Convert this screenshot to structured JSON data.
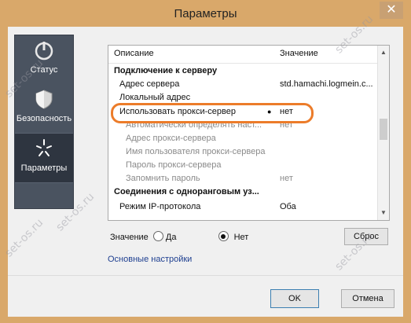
{
  "window": {
    "title": "Параметры",
    "close_glyph": "✕"
  },
  "sidebar": {
    "items": [
      {
        "label": "Статус",
        "icon": "power-icon"
      },
      {
        "label": "Безопасность",
        "icon": "shield-icon"
      },
      {
        "label": "Параметры",
        "icon": "settings-spark-icon",
        "active": true
      }
    ]
  },
  "grid": {
    "headers": {
      "description": "Описание",
      "value": "Значение"
    },
    "rows": [
      {
        "type": "section",
        "description": "Подключение к серверу",
        "value": ""
      },
      {
        "type": "item",
        "description": "Адрес сервера",
        "value": "std.hamachi.logmein.c..."
      },
      {
        "type": "item",
        "description": "Локальный адрес",
        "value": ""
      },
      {
        "type": "item",
        "description": "Использовать прокси-сервер",
        "value": "нет",
        "modified": true
      },
      {
        "type": "dim",
        "description": "Автоматически определять наст...",
        "value": "нет"
      },
      {
        "type": "dim",
        "description": "Адрес прокси-сервера",
        "value": ""
      },
      {
        "type": "dim",
        "description": "Имя пользователя прокси-сервера",
        "value": ""
      },
      {
        "type": "dim",
        "description": "Пароль прокси-сервера",
        "value": ""
      },
      {
        "type": "dim",
        "description": "Запомнить пароль",
        "value": "нет"
      },
      {
        "type": "section",
        "description": "Соединения с одноранговым уз...",
        "value": ""
      },
      {
        "type": "item",
        "description": "Режим IP-протокола",
        "value": "Оба"
      }
    ]
  },
  "value_editor": {
    "label": "Значение",
    "option_yes": "Да",
    "option_no": "Нет",
    "selected": "Нет",
    "reset_label": "Сброс"
  },
  "basic_settings_link": "Основные настройки",
  "buttons": {
    "ok": "OK",
    "cancel": "Отмена"
  },
  "watermark": "set-os.ru",
  "colors": {
    "highlight": "#ec7c2a",
    "sidebar": "#4a5360",
    "titlebar": "#d9a86a"
  }
}
